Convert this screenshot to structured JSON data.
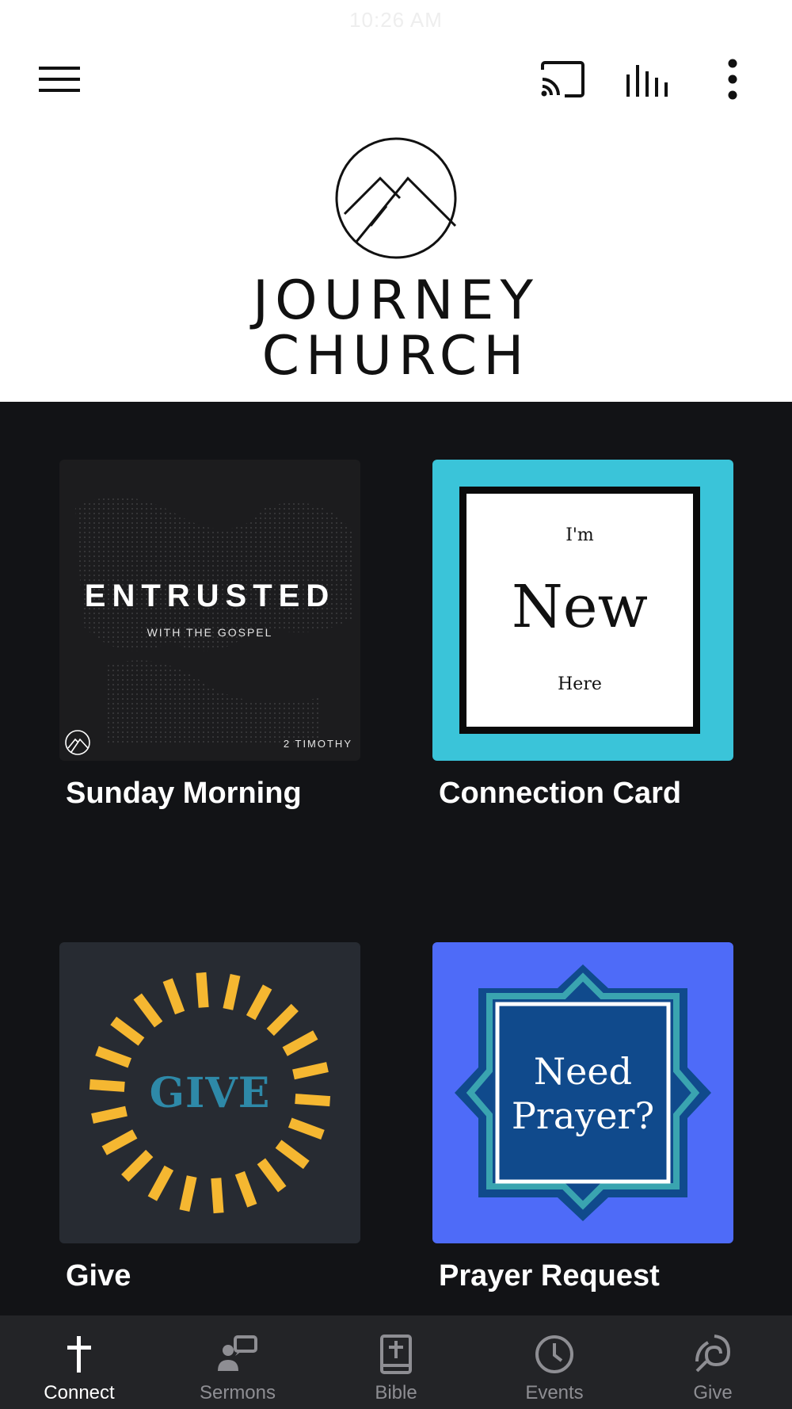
{
  "status_bar": {
    "time": "10:26 AM"
  },
  "header": {
    "logo_line1": "JOURNEY",
    "logo_line2": "CHURCH"
  },
  "tiles": [
    {
      "label": "Sunday Morning",
      "art": {
        "title": "ENTRUSTED",
        "subtitle": "WITH THE GOSPEL",
        "reference": "2 TIMOTHY"
      }
    },
    {
      "label": "Connection Card",
      "art": {
        "line1": "I'm",
        "line2": "New",
        "line3": "Here"
      }
    },
    {
      "label": "Give",
      "art": {
        "word": "GIVE"
      }
    },
    {
      "label": "Prayer Request",
      "art": {
        "line1": "Need",
        "line2": "Prayer?"
      }
    }
  ],
  "bottom_nav": {
    "items": [
      {
        "label": "Connect",
        "icon": "cross-icon",
        "active": true
      },
      {
        "label": "Sermons",
        "icon": "sermons-icon",
        "active": false
      },
      {
        "label": "Bible",
        "icon": "bible-icon",
        "active": false
      },
      {
        "label": "Events",
        "icon": "clock-icon",
        "active": false
      },
      {
        "label": "Give",
        "icon": "give-icon",
        "active": false
      }
    ]
  },
  "colors": {
    "background": "#121316",
    "header_bg": "#ffffff",
    "nav_bg": "#232427",
    "connect_tile": "#3ac4d9",
    "prayer_tile": "#4e6bf8",
    "give_rays": "#f5b731",
    "give_word": "#2e89a8"
  }
}
